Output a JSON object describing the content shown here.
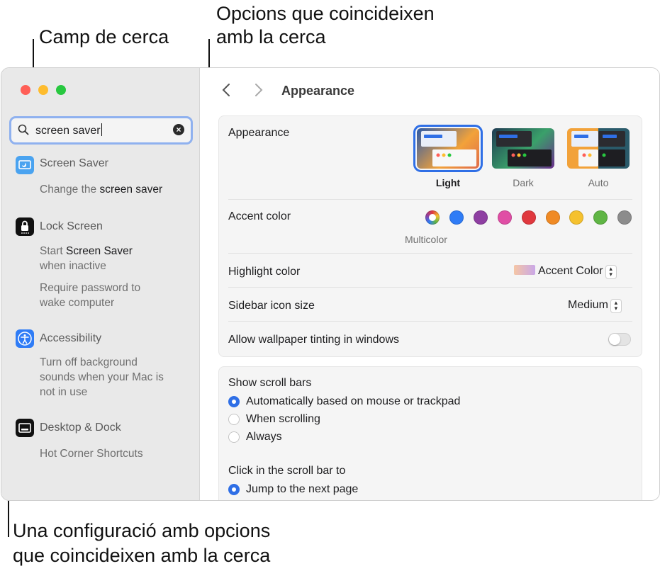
{
  "callouts": {
    "search_field": "Camp de cerca",
    "matching_options_line1": "Opcions que coincideixen",
    "matching_options_line2": "amb la cerca",
    "setting_line1": "Una configuració amb opcions",
    "setting_line2": "que coincideixen amb la cerca"
  },
  "window": {
    "traffic_lights": {
      "close": "#ff5f57",
      "minimize": "#febc2e",
      "zoom": "#28c840"
    }
  },
  "sidebar": {
    "search": {
      "value": "screen saver",
      "icon": "magnifying-glass-icon",
      "clear_icon": "clear-icon"
    },
    "results": [
      {
        "title": "Screen Saver",
        "icon": "screen-saver-icon",
        "options": [
          {
            "pre": "Change the ",
            "match": "screen saver"
          }
        ]
      },
      {
        "title": "Lock Screen",
        "icon": "lock-icon",
        "options": [
          {
            "pre": "Start ",
            "match": "Screen Saver",
            "post": "when inactive"
          },
          {
            "pre": "Require password to",
            "post": "wake computer"
          }
        ]
      },
      {
        "title": "Accessibility",
        "icon": "accessibility-icon",
        "options": [
          {
            "pre": "Turn off background",
            "post": "sounds when your Mac is",
            "post2": "not in use"
          }
        ]
      },
      {
        "title": "Desktop & Dock",
        "icon": "desktop-dock-icon",
        "options": [
          {
            "pre": "Hot Corner Shortcuts"
          }
        ]
      }
    ]
  },
  "main": {
    "title": "Appearance",
    "back_icon": "chevron-left-icon",
    "forward_icon": "chevron-right-icon",
    "appearance": {
      "label": "Appearance",
      "options": [
        "Light",
        "Dark",
        "Auto"
      ],
      "selected": "Light"
    },
    "accent": {
      "label": "Accent color",
      "caption": "Multicolor",
      "colors": [
        "multicolor",
        "#2f7cf6",
        "#8e3fa2",
        "#e04ea5",
        "#e0383e",
        "#f08a24",
        "#f5c12e",
        "#5fb544",
        "#8c8c8c"
      ]
    },
    "highlight": {
      "label": "Highlight color",
      "value": "Accent Color"
    },
    "sidebar_icon_size": {
      "label": "Sidebar icon size",
      "value": "Medium"
    },
    "wallpaper_tinting": {
      "label": "Allow wallpaper tinting in windows",
      "enabled": false
    },
    "scroll_bars": {
      "label": "Show scroll bars",
      "options": [
        "Automatically based on mouse or trackpad",
        "When scrolling",
        "Always"
      ],
      "selected": 0
    },
    "click_scroll": {
      "label": "Click in the scroll bar to",
      "options": [
        "Jump to the next page"
      ],
      "selected": 0
    }
  }
}
